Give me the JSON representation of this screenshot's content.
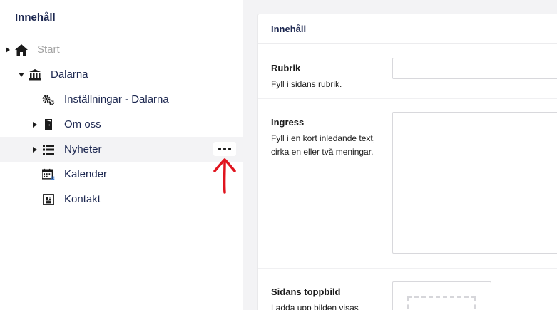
{
  "sidebar": {
    "title": "Innehåll",
    "nodes": [
      {
        "label": "Start",
        "icon": "home-icon",
        "muted": true,
        "caret": "right"
      },
      {
        "label": "Dalarna",
        "icon": "institution-icon",
        "caret": "down"
      },
      {
        "label": "Inställningar - Dalarna",
        "icon": "cogs-icon"
      },
      {
        "label": "Om oss",
        "icon": "door-icon",
        "caret": "right"
      },
      {
        "label": "Nyheter",
        "icon": "list-icon",
        "caret": "right",
        "highlighted": true
      },
      {
        "label": "Kalender",
        "icon": "calendar-icon"
      },
      {
        "label": "Kontakt",
        "icon": "newspaper-icon"
      }
    ],
    "actions_icon": "more-actions-icon",
    "annotation": "red-arrow-annotation"
  },
  "editor": {
    "group_title": "Innehåll",
    "properties": [
      {
        "label": "Rubrik",
        "description": "Fyll i sidans rubrik."
      },
      {
        "label": "Ingress",
        "description": "Fyll i en kort inledande text, cirka en eller två meningar."
      },
      {
        "label": "Sidans toppbild",
        "description": "Ladda upp bilden visas"
      }
    ]
  },
  "colors": {
    "text_primary": "#1b264f",
    "muted": "#a3a3a3",
    "content_background": "#f3f3f5",
    "annotation_red": "#e0141e"
  }
}
